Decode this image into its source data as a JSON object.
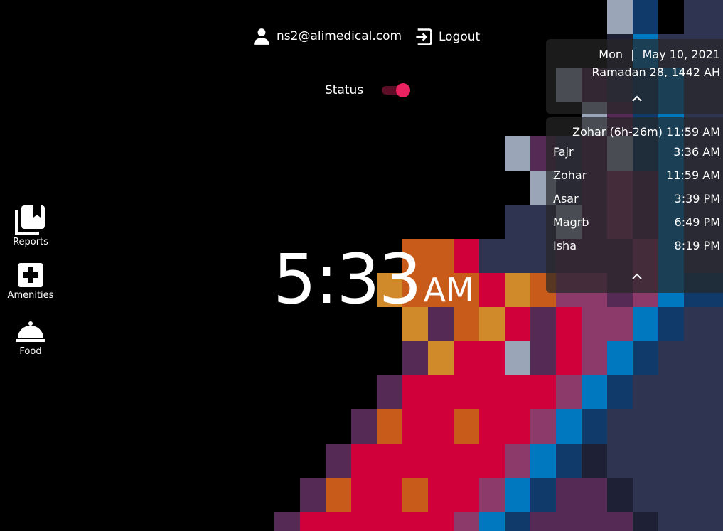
{
  "header": {
    "user_email": "ns2@alimedical.com",
    "logout_label": "Logout",
    "status_label": "Status",
    "status_on": true
  },
  "sidebar": {
    "items": [
      {
        "label": "Reports",
        "icon": "reports-icon"
      },
      {
        "label": "Amenities",
        "icon": "amenities-icon"
      },
      {
        "label": "Food",
        "icon": "food-icon"
      }
    ]
  },
  "clock": {
    "time": "5:33",
    "ampm": "AM"
  },
  "date_panel": {
    "day": "Mon",
    "separator": "|",
    "date": "May 10, 2021",
    "hijri": "Ramadan 28, 1442 AH"
  },
  "prayer_panel": {
    "next": "Zohar (6h-26m)  11:59 AM",
    "prayers": [
      {
        "name": "Fajr",
        "time": "3:36 AM"
      },
      {
        "name": "Zohar",
        "time": "11:59 AM"
      },
      {
        "name": "Asar",
        "time": "3:39 PM"
      },
      {
        "name": "Magrb",
        "time": "6:49 PM"
      },
      {
        "name": "Isha",
        "time": "8:19 PM"
      }
    ]
  },
  "colors": {
    "background": "#000000",
    "toggle_thumb": "#e8235f",
    "toggle_track": "#5a0f26",
    "mosaic_red": "#d0003a",
    "mosaic_orange": "#c85a1a",
    "mosaic_gold": "#d08a2a",
    "mosaic_purple": "#552a55",
    "mosaic_magenta": "#8c3a6a",
    "mosaic_blue": "#0078c0",
    "mosaic_navy": "#103a6a",
    "mosaic_slate": "#2f3550",
    "mosaic_grey": "#9aa6b8"
  }
}
